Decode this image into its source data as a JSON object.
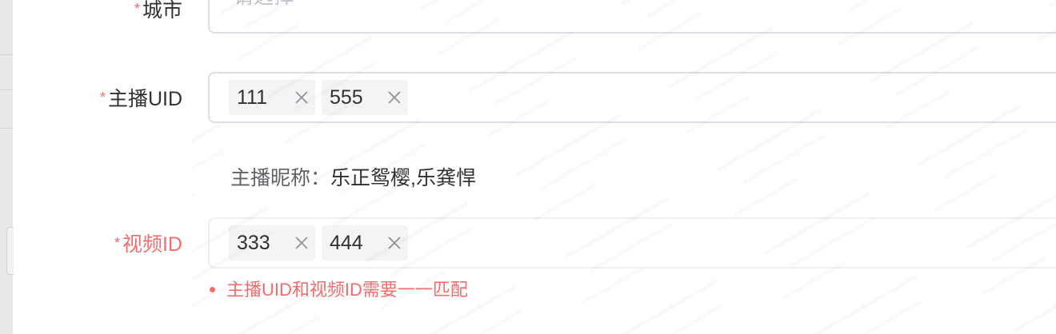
{
  "form": {
    "city": {
      "label": "城市",
      "placeholder": "请选择"
    },
    "anchor_uid": {
      "label": "主播UID",
      "tags": [
        "111",
        "555"
      ]
    },
    "anchor_nickname": {
      "label": "主播昵称：",
      "value": "乐正鸳樱,乐龚悍"
    },
    "video_id": {
      "label": "视频ID",
      "tags": [
        "333",
        "444"
      ],
      "error": "主播UID和视频ID需要一一匹配"
    },
    "required_mark": "*"
  },
  "colors": {
    "error": "#f56c6c",
    "border": "#dcdfe6",
    "tag_bg": "#f4f4f5",
    "text": "#303133",
    "placeholder": "#c0c4cc"
  }
}
